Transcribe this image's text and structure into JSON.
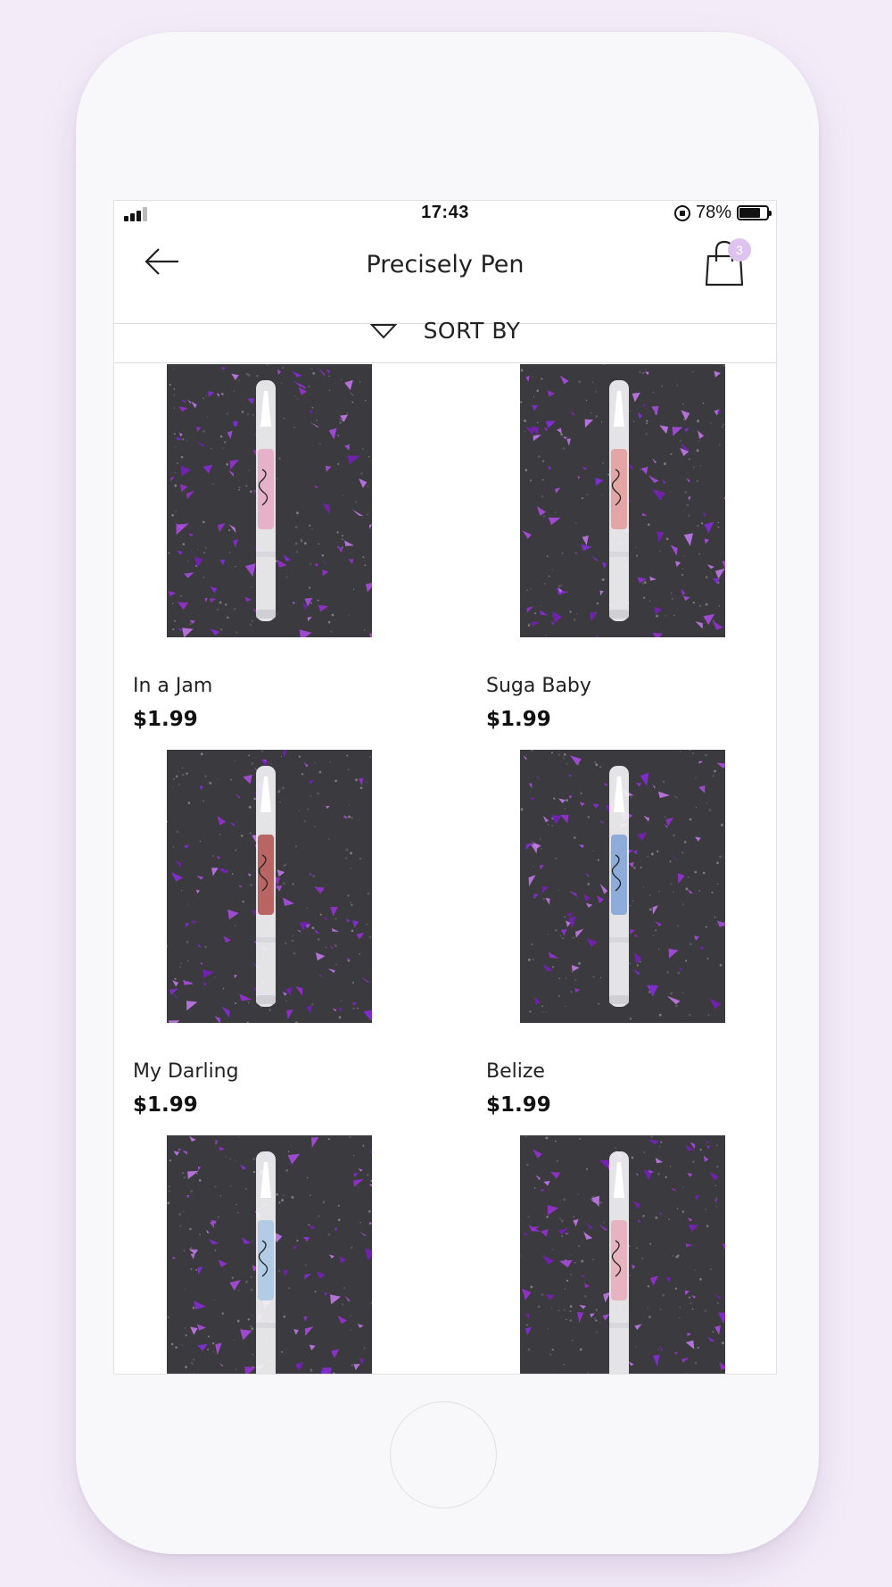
{
  "status_bar": {
    "time": "17:43",
    "battery": "78%",
    "battery_level": 0.78
  },
  "header": {
    "title": "Precisely Pen",
    "back_icon": "arrow-left-icon",
    "cart_icon": "shopping-bag-icon",
    "cart_count": "3"
  },
  "sort": {
    "label": "SORT BY",
    "icon": "triangle-down-icon"
  },
  "colors": {
    "accent": "#dcc4ee",
    "background": "#f3ecf8",
    "confetti": "#9b30d8"
  },
  "products": [
    {
      "name": "In a Jam",
      "price": "$1.99",
      "liquid_color": "#e6a9c4"
    },
    {
      "name": "Suga Baby",
      "price": "$1.99",
      "liquid_color": "#e39a99"
    },
    {
      "name": "My Darling",
      "price": "$1.99",
      "liquid_color": "#b24f4b"
    },
    {
      "name": "Belize",
      "price": "$1.99",
      "liquid_color": "#7fa2d6"
    },
    {
      "name": "",
      "price": "",
      "liquid_color": "#a9c8e4"
    },
    {
      "name": "",
      "price": "",
      "liquid_color": "#e8aab8"
    }
  ]
}
